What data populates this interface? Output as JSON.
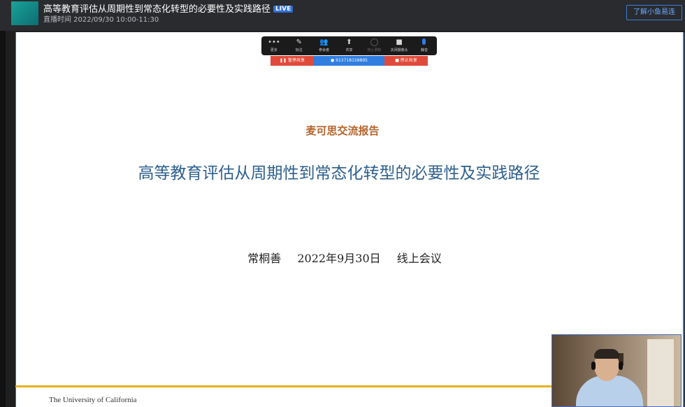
{
  "header": {
    "title": "高等教育评估从周期性到常态化转型的必要性及实践路径",
    "live_badge": "LIVE",
    "subtitle": "直播时间 2022/09/30 10:00-11:30",
    "learn_button": "了解小鱼易连"
  },
  "meeting_toolbar": {
    "items": [
      {
        "label": "更多",
        "icon": "more-icon"
      },
      {
        "label": "标注",
        "icon": "pen-icon"
      },
      {
        "label": "参会者",
        "icon": "participants-icon"
      },
      {
        "label": "共享",
        "icon": "share-screen-icon"
      },
      {
        "label": "停止录制",
        "icon": "record-icon"
      },
      {
        "label": "关闭摄像头",
        "icon": "camera-icon"
      },
      {
        "label": "静音",
        "icon": "mic-icon"
      }
    ],
    "pause_share": "暂停共享",
    "meeting_id": "913718158895",
    "stop_share": "停止共享"
  },
  "slide": {
    "kicker": "麦可思交流报告",
    "title": "高等教育评估从周期性到常态化转型的必要性及实践路径",
    "speaker": "常桐善",
    "date": "2022年9月30日",
    "venue": "线上会议",
    "footer": "The University of California",
    "accent_color": "#e8b020",
    "title_color": "#2d5f8e"
  }
}
